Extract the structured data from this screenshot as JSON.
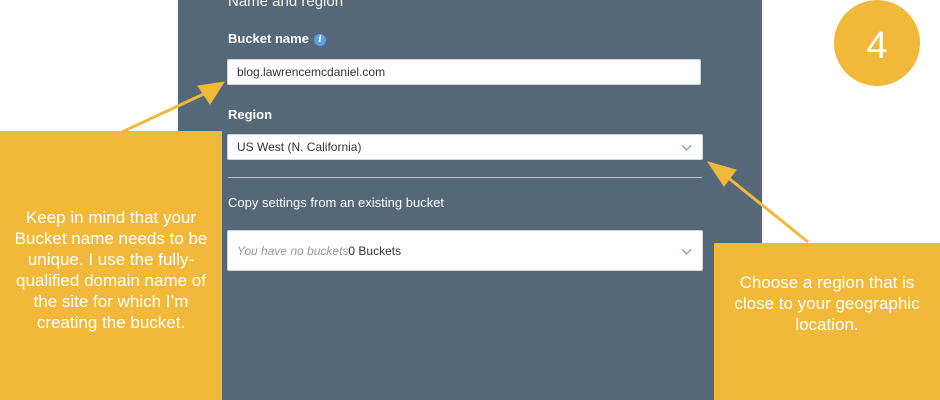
{
  "form": {
    "section_title": "Name and region",
    "bucket_name_label": "Bucket name",
    "bucket_name_value": "blog.lawrencemcdaniel.com",
    "region_label": "Region",
    "region_value": "US West (N. California)",
    "copy_settings_label": "Copy settings from an existing bucket",
    "copy_settings_placeholder": "You have no buckets",
    "copy_settings_count": "0 Buckets"
  },
  "annotations": {
    "step_number": "4",
    "left_callout": "Keep in mind that your Bucket name needs to be unique. I use the fully-qualified domain name of the site for which I’m creating the bucket.",
    "right_callout": "Choose a region that is close to your geographic location."
  },
  "colors": {
    "panel": "#55687a",
    "callout": "#f1b83a",
    "accent_link": "#5aa0e8"
  }
}
